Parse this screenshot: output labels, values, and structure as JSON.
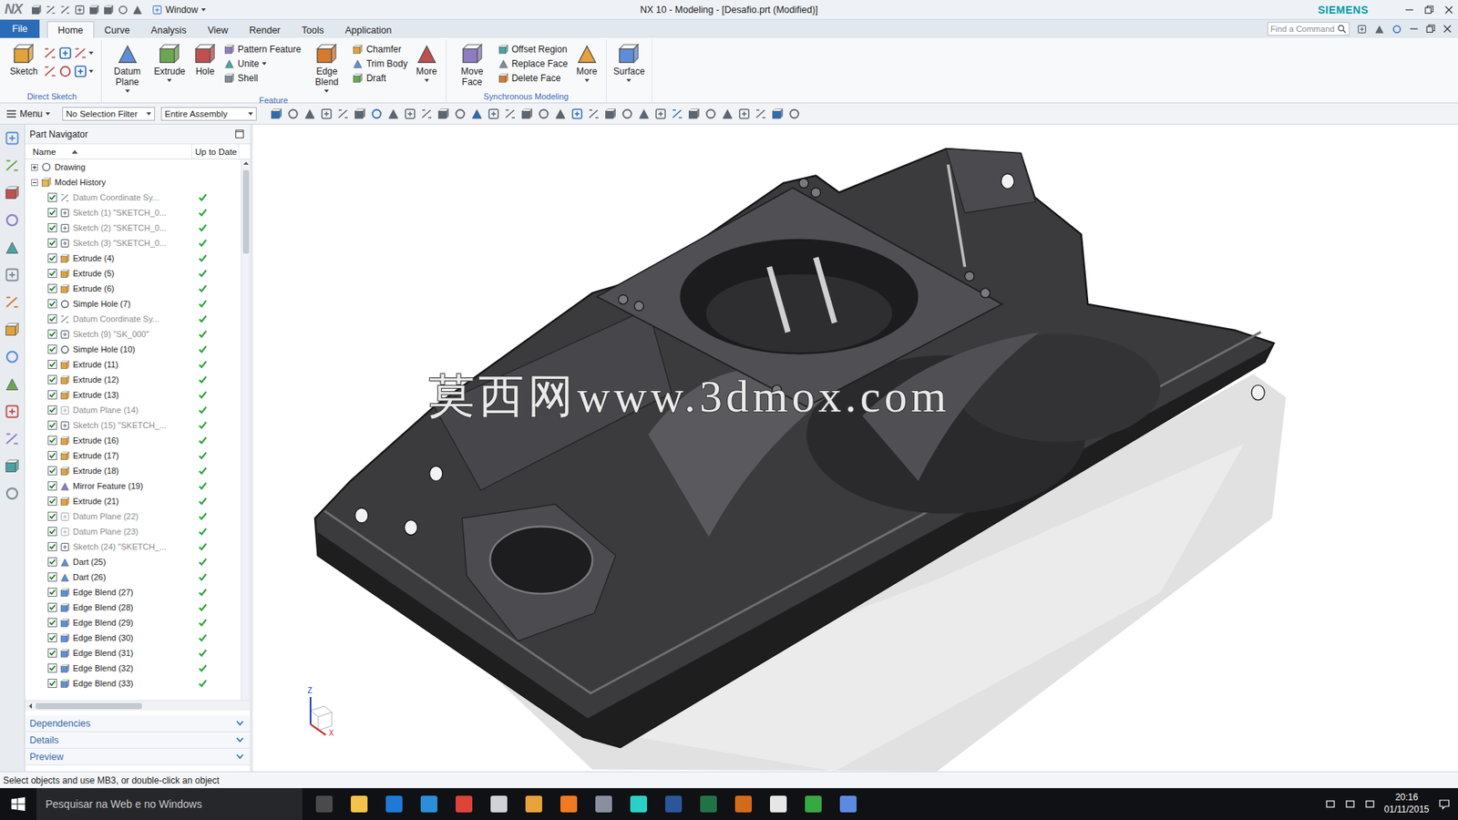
{
  "window": {
    "logo": "NX",
    "menu_button": "Window",
    "title": "NX 10 - Modeling - [Desafio.prt (Modified)]",
    "brand": "SIEMENS"
  },
  "tabs": [
    {
      "label": "File",
      "selected": false,
      "kind": "file"
    },
    {
      "label": "Home",
      "selected": true,
      "kind": "tab"
    },
    {
      "label": "Curve",
      "selected": false,
      "kind": "tab"
    },
    {
      "label": "Analysis",
      "selected": false,
      "kind": "tab"
    },
    {
      "label": "View",
      "selected": false,
      "kind": "tab"
    },
    {
      "label": "Render",
      "selected": false,
      "kind": "tab"
    },
    {
      "label": "Tools",
      "selected": false,
      "kind": "tab"
    },
    {
      "label": "Application",
      "selected": false,
      "kind": "tab"
    }
  ],
  "command_search": {
    "placeholder": "Find a Command"
  },
  "ribbon": {
    "groups": [
      {
        "label": "Direct Sketch",
        "items": [
          {
            "kind": "big",
            "label": "Sketch",
            "dropdown": false
          },
          {
            "kind": "tools"
          }
        ]
      },
      {
        "label": "Feature",
        "items": [
          {
            "kind": "big",
            "label": "Datum Plane",
            "dropdown": true
          },
          {
            "kind": "big",
            "label": "Extrude",
            "dropdown": true
          },
          {
            "kind": "big",
            "label": "Hole",
            "dropdown": false
          },
          {
            "kind": "stack",
            "entries": [
              {
                "label": "Pattern Feature",
                "dropdown": false
              },
              {
                "label": "Unite",
                "dropdown": true
              },
              {
                "label": "Shell",
                "dropdown": false
              }
            ]
          },
          {
            "kind": "big",
            "label": "Edge Blend",
            "dropdown": true
          },
          {
            "kind": "stack",
            "entries": [
              {
                "label": "Chamfer",
                "dropdown": false
              },
              {
                "label": "Trim Body",
                "dropdown": false
              },
              {
                "label": "Draft",
                "dropdown": false
              }
            ]
          },
          {
            "kind": "big",
            "label": "More",
            "dropdown": true
          }
        ]
      },
      {
        "label": "Synchronous Modeling",
        "items": [
          {
            "kind": "big",
            "label": "Move Face",
            "dropdown": false
          },
          {
            "kind": "stack",
            "entries": [
              {
                "label": "Offset Region",
                "dropdown": false
              },
              {
                "label": "Replace Face",
                "dropdown": false
              },
              {
                "label": "Delete Face",
                "dropdown": false
              }
            ]
          },
          {
            "kind": "big",
            "label": "More",
            "dropdown": true
          }
        ]
      },
      {
        "items": [
          {
            "kind": "big",
            "label": "Surface",
            "dropdown": true
          }
        ]
      }
    ]
  },
  "selection_bar": {
    "menu": "Menu",
    "filter": "No Selection Filter",
    "scope": "Entire Assembly"
  },
  "navigator": {
    "title": "Part Navigator",
    "columns": [
      "Name",
      "Up to Date"
    ],
    "rows": [
      {
        "name": "Drawing",
        "kind": "folder",
        "type": "drawing",
        "expanded": false
      },
      {
        "name": "Model History",
        "kind": "folder",
        "type": "history",
        "expanded": true
      },
      {
        "name": "Datum Coordinate Sy...",
        "kind": "feature",
        "type": "datum-csys",
        "checked": true,
        "dimmed": true,
        "up_to_date": true
      },
      {
        "name": "Sketch (1) \"SKETCH_0...",
        "kind": "feature",
        "type": "sketch",
        "checked": true,
        "dimmed": true,
        "up_to_date": true
      },
      {
        "name": "Sketch (2) \"SKETCH_0...",
        "kind": "feature",
        "type": "sketch",
        "checked": true,
        "dimmed": true,
        "up_to_date": true
      },
      {
        "name": "Sketch (3) \"SKETCH_0...",
        "kind": "feature",
        "type": "sketch",
        "checked": true,
        "dimmed": true,
        "up_to_date": true
      },
      {
        "name": "Extrude (4)",
        "kind": "feature",
        "type": "extrude",
        "checked": true,
        "dimmed": false,
        "up_to_date": true
      },
      {
        "name": "Extrude (5)",
        "kind": "feature",
        "type": "extrude",
        "checked": true,
        "dimmed": false,
        "up_to_date": true
      },
      {
        "name": "Extrude (6)",
        "kind": "feature",
        "type": "extrude",
        "checked": true,
        "dimmed": false,
        "up_to_date": true
      },
      {
        "name": "Simple Hole (7)",
        "kind": "feature",
        "type": "hole",
        "checked": true,
        "dimmed": false,
        "up_to_date": true
      },
      {
        "name": "Datum Coordinate Sy...",
        "kind": "feature",
        "type": "datum-csys",
        "checked": true,
        "dimmed": true,
        "up_to_date": true
      },
      {
        "name": "Sketch (9) \"SK_000\"",
        "kind": "feature",
        "type": "sketch",
        "checked": true,
        "dimmed": true,
        "up_to_date": true
      },
      {
        "name": "Simple Hole (10)",
        "kind": "feature",
        "type": "hole",
        "checked": true,
        "dimmed": false,
        "up_to_date": true
      },
      {
        "name": "Extrude (11)",
        "kind": "feature",
        "type": "extrude",
        "checked": true,
        "dimmed": false,
        "up_to_date": true
      },
      {
        "name": "Extrude (12)",
        "kind": "feature",
        "type": "extrude",
        "checked": true,
        "dimmed": false,
        "up_to_date": true
      },
      {
        "name": "Extrude (13)",
        "kind": "feature",
        "type": "extrude",
        "checked": true,
        "dimmed": false,
        "up_to_date": true
      },
      {
        "name": "Datum Plane (14)",
        "kind": "feature",
        "type": "datum-plane",
        "checked": true,
        "dimmed": true,
        "up_to_date": true
      },
      {
        "name": "Sketch (15) \"SKETCH_...",
        "kind": "feature",
        "type": "sketch",
        "checked": true,
        "dimmed": true,
        "up_to_date": true
      },
      {
        "name": "Extrude (16)",
        "kind": "feature",
        "type": "extrude",
        "checked": true,
        "dimmed": false,
        "up_to_date": true
      },
      {
        "name": "Extrude (17)",
        "kind": "feature",
        "type": "extrude",
        "checked": true,
        "dimmed": false,
        "up_to_date": true
      },
      {
        "name": "Extrude (18)",
        "kind": "feature",
        "type": "extrude",
        "checked": true,
        "dimmed": false,
        "up_to_date": true
      },
      {
        "name": "Mirror Feature (19)",
        "kind": "feature",
        "type": "mirror",
        "checked": true,
        "dimmed": false,
        "up_to_date": true
      },
      {
        "name": "Extrude (21)",
        "kind": "feature",
        "type": "extrude",
        "checked": true,
        "dimmed": false,
        "up_to_date": true
      },
      {
        "name": "Datum Plane (22)",
        "kind": "feature",
        "type": "datum-plane",
        "checked": true,
        "dimmed": true,
        "up_to_date": true
      },
      {
        "name": "Datum Plane (23)",
        "kind": "feature",
        "type": "datum-plane",
        "checked": true,
        "dimmed": true,
        "up_to_date": true
      },
      {
        "name": "Sketch (24) \"SKETCH_...",
        "kind": "feature",
        "type": "sketch",
        "checked": true,
        "dimmed": true,
        "up_to_date": true
      },
      {
        "name": "Dart (25)",
        "kind": "feature",
        "type": "dart",
        "checked": true,
        "dimmed": false,
        "up_to_date": true
      },
      {
        "name": "Dart (26)",
        "kind": "feature",
        "type": "dart",
        "checked": true,
        "dimmed": false,
        "up_to_date": true
      },
      {
        "name": "Edge Blend (27)",
        "kind": "feature",
        "type": "edge-blend",
        "checked": true,
        "dimmed": false,
        "up_to_date": true
      },
      {
        "name": "Edge Blend (28)",
        "kind": "feature",
        "type": "edge-blend",
        "checked": true,
        "dimmed": false,
        "up_to_date": true
      },
      {
        "name": "Edge Blend (29)",
        "kind": "feature",
        "type": "edge-blend",
        "checked": true,
        "dimmed": false,
        "up_to_date": true
      },
      {
        "name": "Edge Blend (30)",
        "kind": "feature",
        "type": "edge-blend",
        "checked": true,
        "dimmed": false,
        "up_to_date": true
      },
      {
        "name": "Edge Blend (31)",
        "kind": "feature",
        "type": "edge-blend",
        "checked": true,
        "dimmed": false,
        "up_to_date": true
      },
      {
        "name": "Edge Blend (32)",
        "kind": "feature",
        "type": "edge-blend",
        "checked": true,
        "dimmed": false,
        "up_to_date": true
      },
      {
        "name": "Edge Blend (33)",
        "kind": "feature",
        "type": "edge-blend",
        "checked": true,
        "dimmed": false,
        "up_to_date": true
      }
    ],
    "sections": [
      {
        "label": "Dependencies",
        "expanded": false
      },
      {
        "label": "Details",
        "expanded": false
      },
      {
        "label": "Preview",
        "expanded": false
      }
    ]
  },
  "graphics": {
    "watermark": "莫西网www.3dmox.com",
    "triad_axes": [
      "Z",
      "X"
    ]
  },
  "status_bar": {
    "prompt": "Select objects and use MB3, or double-click an object"
  },
  "taskbar": {
    "search": "Pesquisar na Web e no Windows",
    "time": "20:16",
    "date": "01/11/2015"
  }
}
